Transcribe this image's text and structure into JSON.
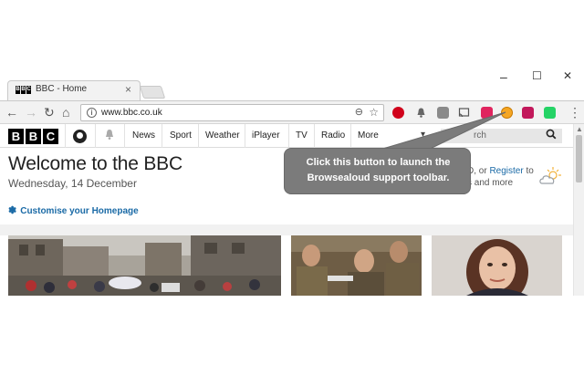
{
  "browser": {
    "tab": {
      "favicon_letters": [
        "B",
        "B",
        "C"
      ],
      "title": "BBC - Home",
      "close": "×"
    },
    "window_controls": {
      "minimize": "–",
      "maximize": "☐",
      "close": "✕"
    },
    "nav": {
      "back": "←",
      "forward": "→",
      "reload": "↻",
      "home": "⌂"
    },
    "omnibox": {
      "info": "i",
      "url": "www.bbc.co.uk",
      "zoom": "⊖",
      "star": "☆"
    },
    "extensions": [
      {
        "name": "pinterest-icon",
        "color": "#d0021b"
      },
      {
        "name": "bell-icon",
        "color": "#555555"
      },
      {
        "name": "pocket-icon",
        "color": "#777777"
      },
      {
        "name": "cast-icon",
        "color": "#555555"
      },
      {
        "name": "flag-icon",
        "color": "#e0245e"
      },
      {
        "name": "browsealoud-icon",
        "color": "#f5a623"
      },
      {
        "name": "gallery-icon",
        "color": "#c2185b"
      },
      {
        "name": "whatsapp-icon",
        "color": "#25d366"
      }
    ],
    "menu": "⋮"
  },
  "bbc": {
    "logo_letters": [
      "B",
      "B",
      "C"
    ],
    "nav_items": [
      "News",
      "Sport",
      "Weather",
      "iPlayer",
      "TV",
      "Radio",
      "More"
    ],
    "more_arrow": "▾",
    "search_placeholder": "rch",
    "welcome": "Welcome to the BBC",
    "date": "Wednesday, 14 December",
    "signin_line1_prefix": "D, or ",
    "register": "Register",
    "signin_line1_suffix": " to",
    "signin_line2": "s and more",
    "customise": "Customise your Homepage"
  },
  "callout": {
    "text": "Click this button to launch the\nBrowsealoud support toolbar."
  },
  "colors": {
    "bbc_link": "#1a6aa6",
    "callout_bg": "#7b7b7b"
  }
}
